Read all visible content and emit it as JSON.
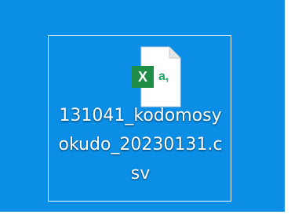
{
  "desktop": {
    "background_color": "#0a8ee6",
    "outer_border_color": "#ffffff"
  },
  "file": {
    "name_lines": [
      "131041_kodomosy",
      "okudo_20230131.c",
      "sv"
    ],
    "icon": "csv-excel-file-icon",
    "icon_badge_text": "X",
    "icon_corner_text": "a,"
  }
}
